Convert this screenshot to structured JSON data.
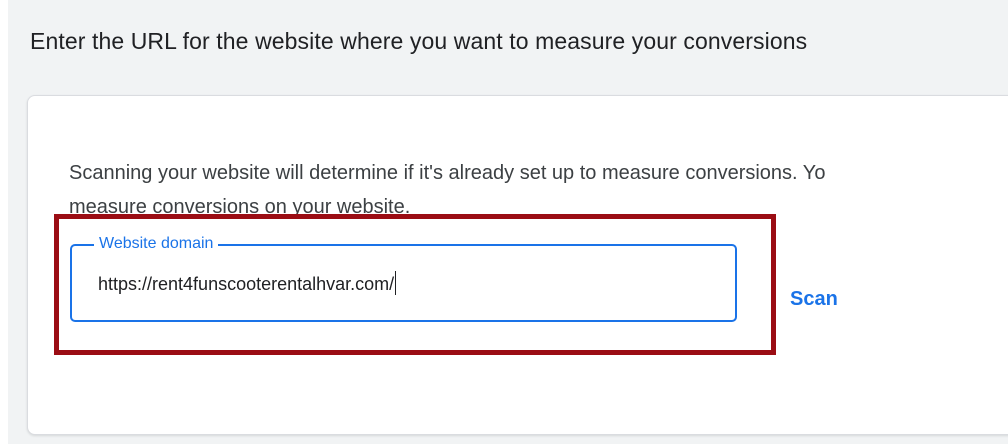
{
  "header": {
    "title": "Enter the URL for the website where you want to measure your conversions"
  },
  "card": {
    "description_line1": "Scanning your website will determine if it's already set up to measure conversions. Yo",
    "description_line2": "measure conversions on your website.",
    "domain_field": {
      "label": "Website domain",
      "value": "https://rent4funscooterentalhvar.com/"
    },
    "scan_label": "Scan"
  },
  "colors": {
    "accent": "#1a73e8",
    "highlight": "#9b0d14",
    "background": "#f1f3f4"
  }
}
